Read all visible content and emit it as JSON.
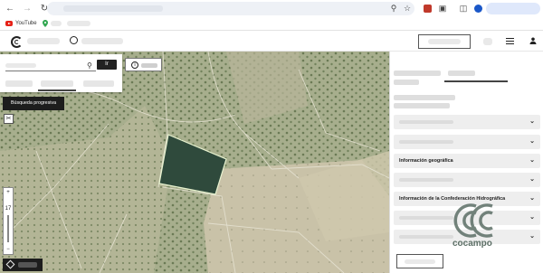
{
  "browser": {
    "bookmarks": [
      {
        "label": "YouTube"
      }
    ]
  },
  "map_panel": {
    "search_button_label": "Ir",
    "progressive_search_label": "Búsqueda progresiva",
    "zoom": {
      "plus": "+",
      "level": "17",
      "minus": "−"
    }
  },
  "right_panel": {
    "sections": [
      {
        "label": ""
      },
      {
        "label": ""
      },
      {
        "label": "Información geográfica"
      },
      {
        "label": ""
      },
      {
        "label": "Información de la Confederación Hidrográfica"
      },
      {
        "label": ""
      },
      {
        "label": ""
      }
    ]
  },
  "watermark": {
    "text": "cocampo"
  },
  "colors": {
    "accent_dark": "#1d1d1d",
    "parcel_highlight": "#2f4a3c",
    "watermark": "#5c6f66"
  }
}
